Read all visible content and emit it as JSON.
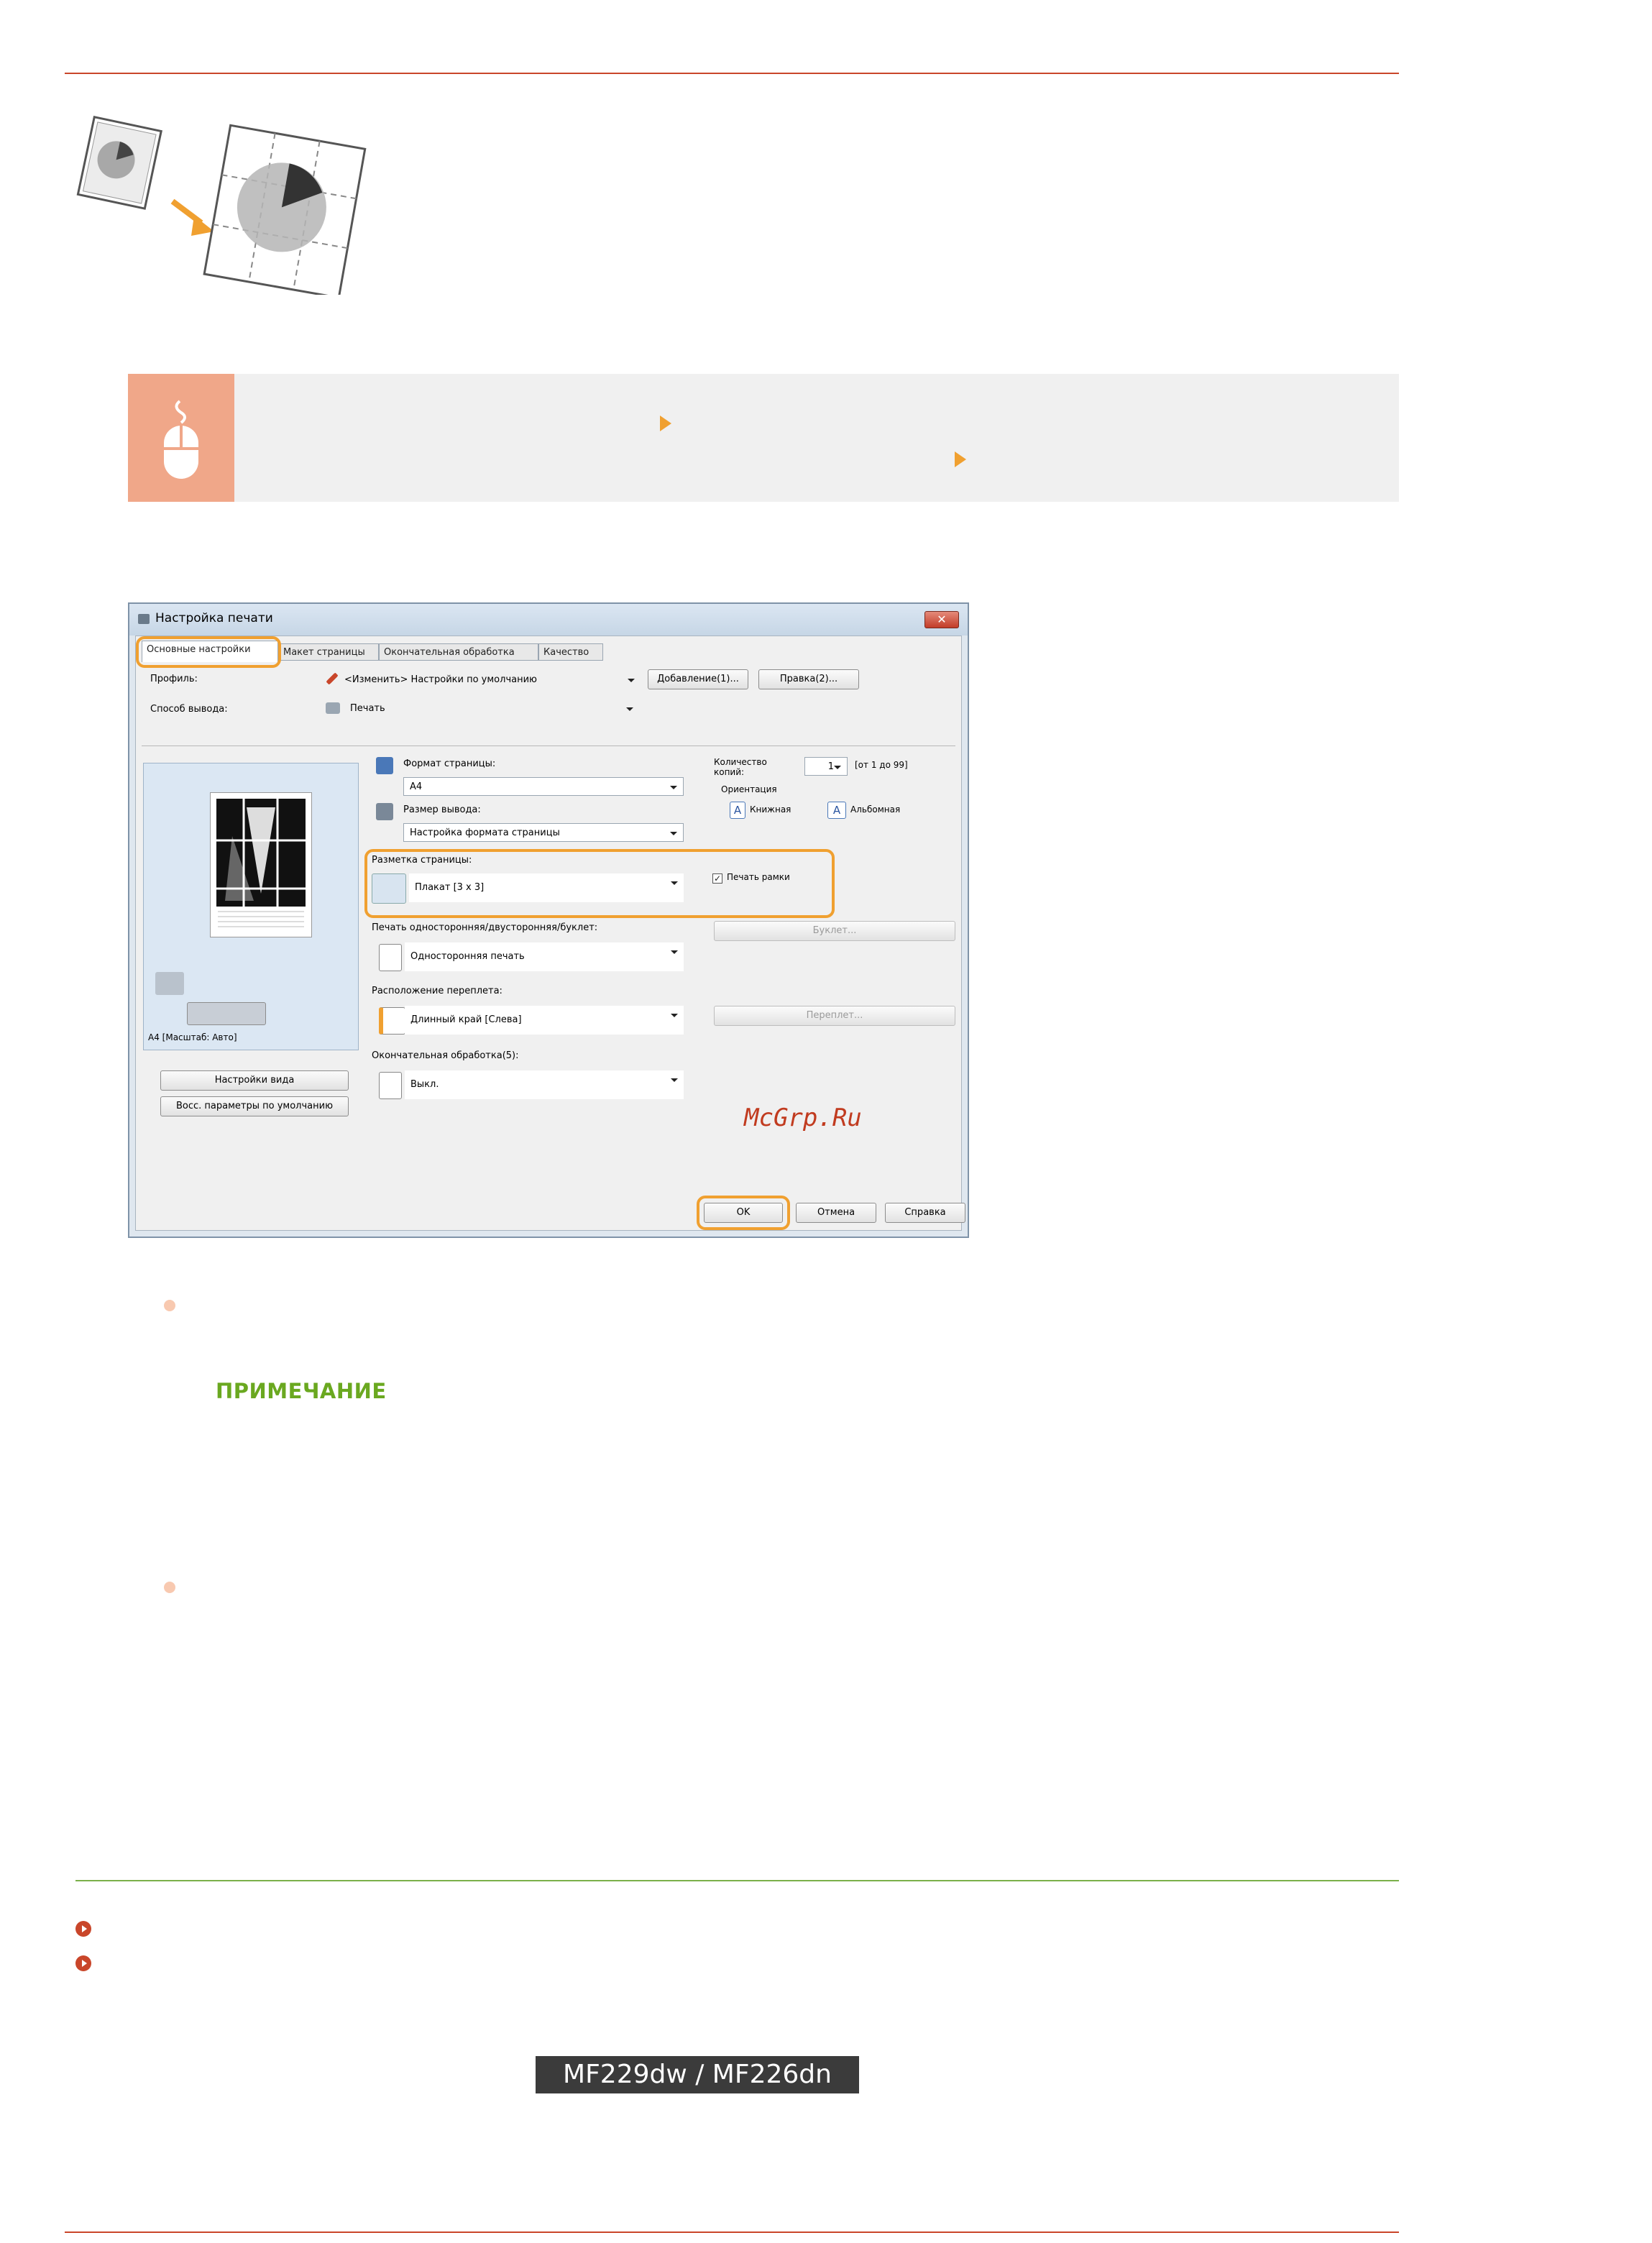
{
  "dialog": {
    "title": "Настройка печати",
    "tabs": [
      "Основные настройки",
      "Макет страницы",
      "Окончательная обработка",
      "Качество"
    ],
    "profile_label": "Профиль:",
    "profile_value": "<Изменить> Настройки по умолчанию",
    "add_button": "Добавление(1)...",
    "edit_button": "Правка(2)...",
    "output_label": "Способ вывода:",
    "output_value": "Печать",
    "page_size_label": "Формат страницы:",
    "page_size_value": "A4",
    "output_size_label": "Размер вывода:",
    "output_size_value": "Настройка формата страницы",
    "copies_label": "Количество копий:",
    "copies_value": "1",
    "copies_range": "[от 1 до 99]",
    "orientation_label": "Ориентация",
    "portrait": "Книжная",
    "landscape": "Альбомная",
    "layout_label": "Разметка страницы:",
    "layout_value": "Плакат [3 x 3]",
    "print_frames": "Печать рамки",
    "duplex_label": "Печать односторонняя/двусторонняя/буклет:",
    "duplex_value": "Односторонняя печать",
    "booklet_button": "Буклет...",
    "binding_label": "Расположение переплета:",
    "binding_value": "Длинный край [Слева]",
    "binding_button": "Переплет...",
    "finishing_label": "Окончательная обработка(5):",
    "finishing_value": "Выкл.",
    "preview_caption": "A4 [Масштаб: Авто]",
    "view_settings_button": "Настройки вида",
    "restore_button": "Восс. параметры по умолчанию",
    "ok_button": "OK",
    "cancel_button": "Отмена",
    "help_button": "Справка"
  },
  "watermark": "McGrp.Ru",
  "note_heading": "ПРИМЕЧАНИЕ",
  "footer_model": "MF229dw / MF226dn",
  "colors": {
    "accent_red": "#c9462a",
    "highlight_orange": "#f0a030",
    "note_green": "#6aa820"
  }
}
